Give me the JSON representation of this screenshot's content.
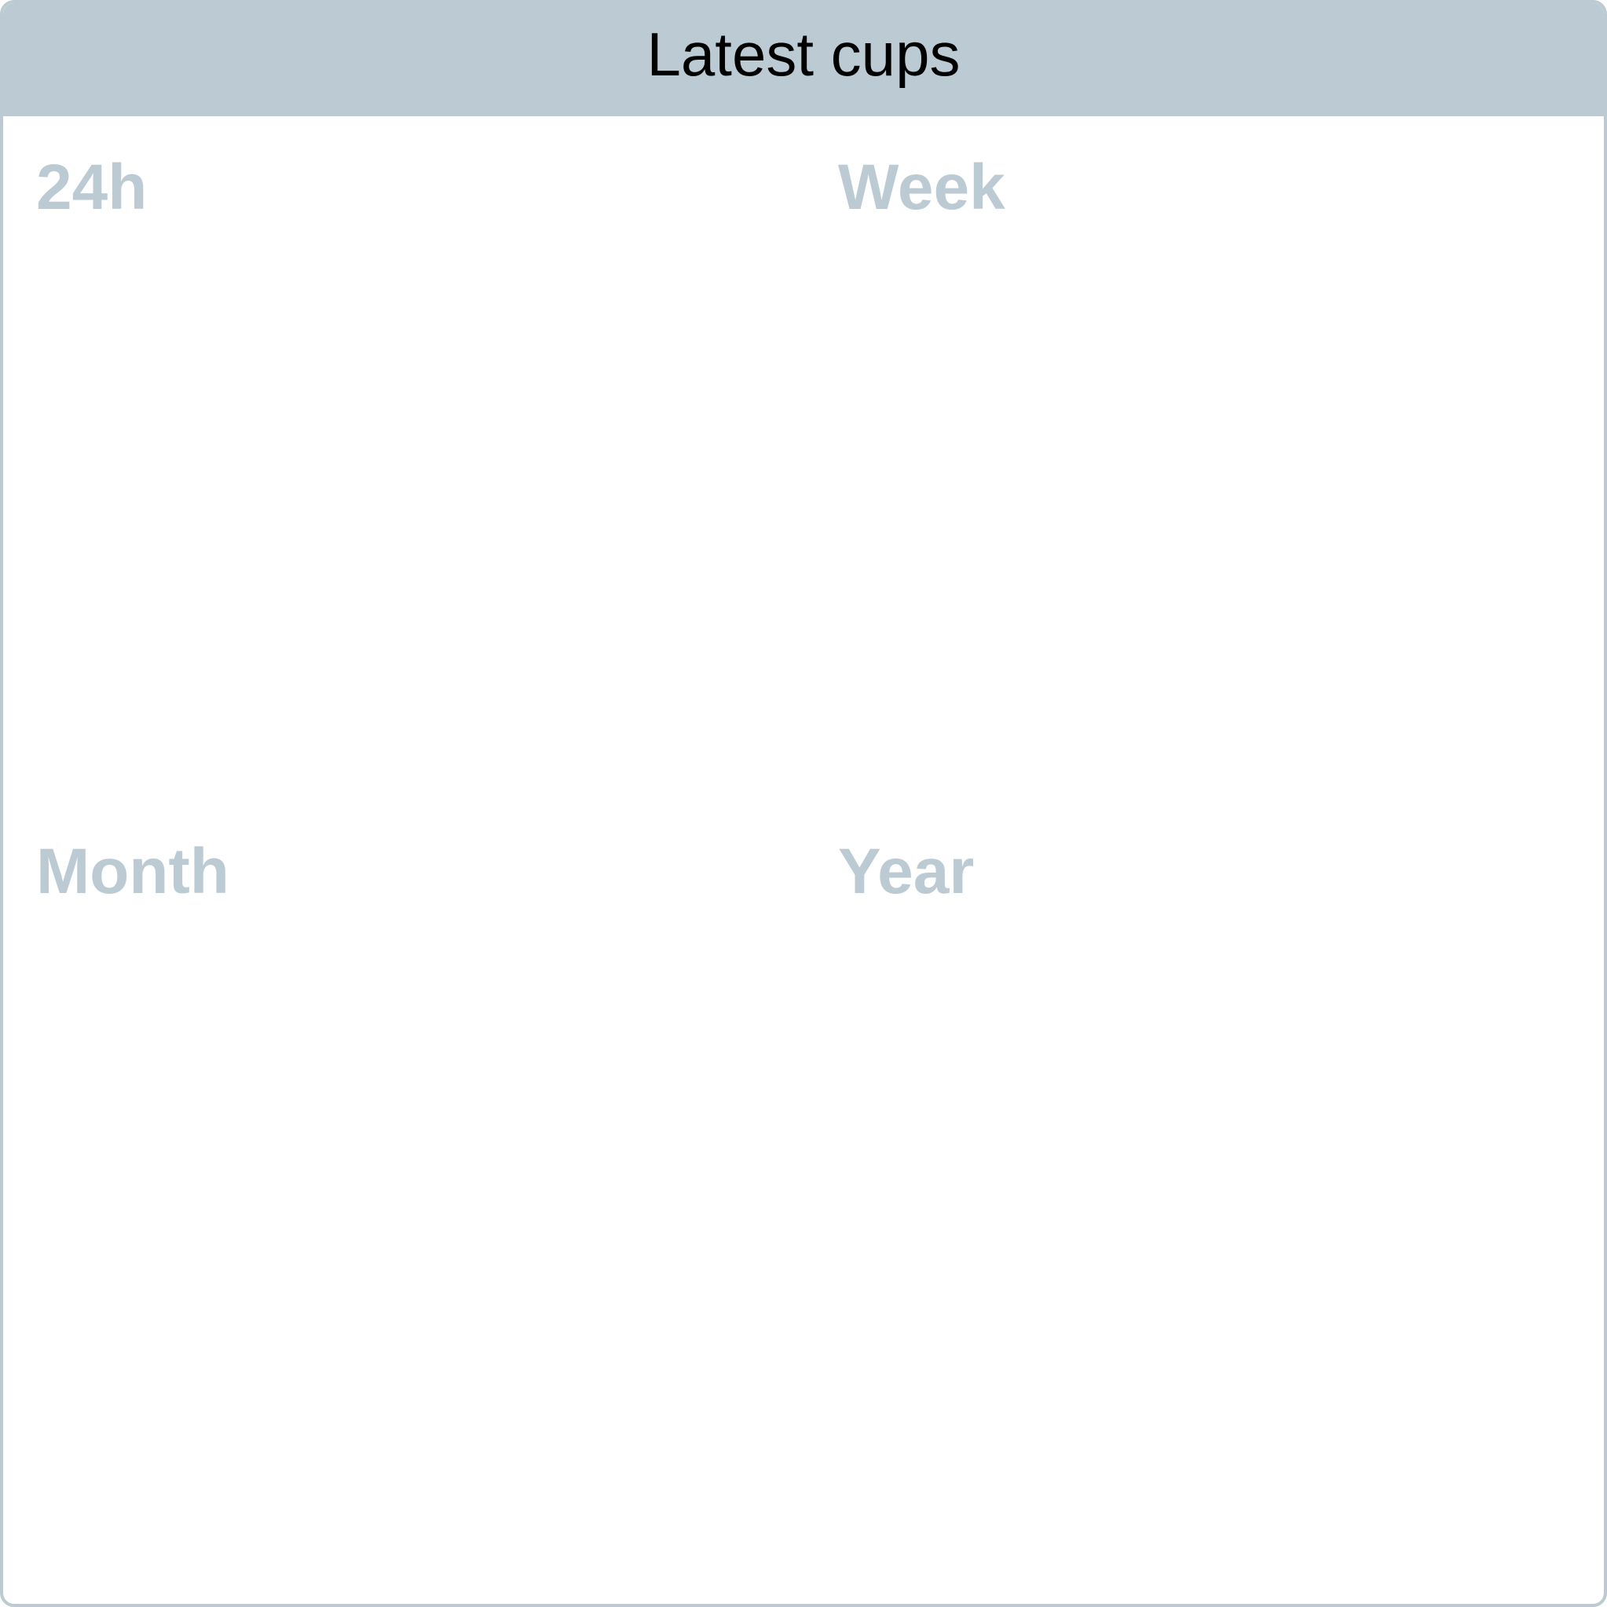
{
  "header": {
    "title": "Latest cups"
  },
  "panels": [
    {
      "label": "24h"
    },
    {
      "label": "Week"
    },
    {
      "label": "Month"
    },
    {
      "label": "Year"
    }
  ],
  "colors": {
    "header_bg": "#bccbd3",
    "label_text": "#bccbd3",
    "title_text": "#000000",
    "card_bg": "#ffffff"
  }
}
